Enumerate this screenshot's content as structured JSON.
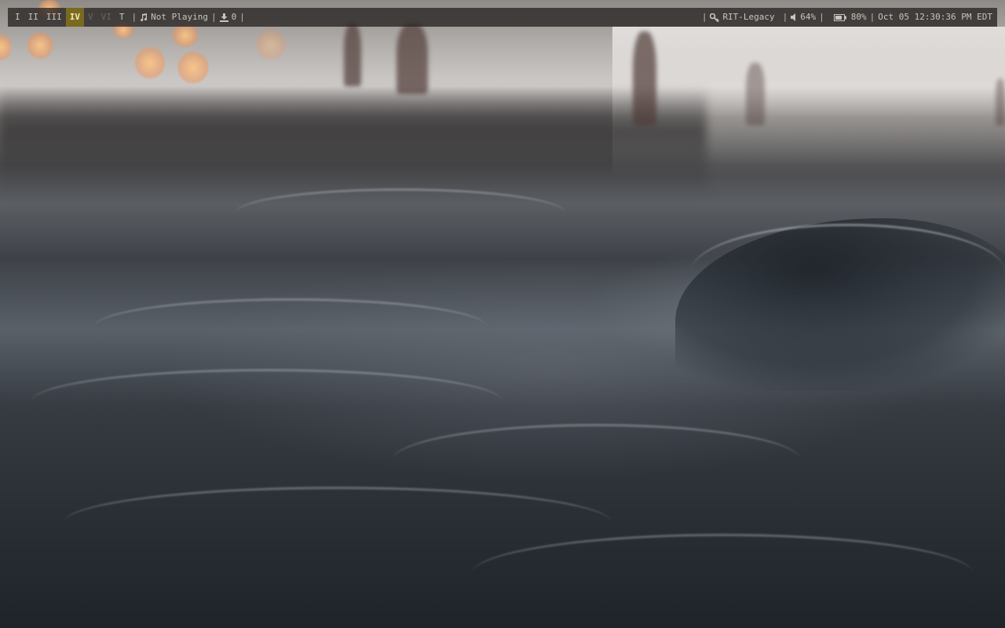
{
  "workspaces": [
    {
      "label": "I",
      "state": "occupied"
    },
    {
      "label": "II",
      "state": "occupied"
    },
    {
      "label": "III",
      "state": "occupied"
    },
    {
      "label": "IV",
      "state": "active"
    },
    {
      "label": "V",
      "state": "empty"
    },
    {
      "label": "VI",
      "state": "empty"
    },
    {
      "label": "T",
      "state": "occupied"
    }
  ],
  "separator": "|",
  "music": {
    "icon": "music-note-icon",
    "text": "Not Playing"
  },
  "updates": {
    "icon": "download-icon",
    "count": "0"
  },
  "network": {
    "icon": "wifi-key-icon",
    "ssid": "RIT-Legacy"
  },
  "volume": {
    "icon": "speaker-icon",
    "text": "64%"
  },
  "battery": {
    "icon": "battery-icon",
    "text": "80%",
    "level": 0.8
  },
  "clock": {
    "text": "Oct 05 12:30:36 PM EDT"
  },
  "colors": {
    "bar_bg": "#262422",
    "bar_fg": "#c9c4bd",
    "active_ws_bg": "#7a6a1f",
    "empty_ws_fg": "#6b6762"
  }
}
